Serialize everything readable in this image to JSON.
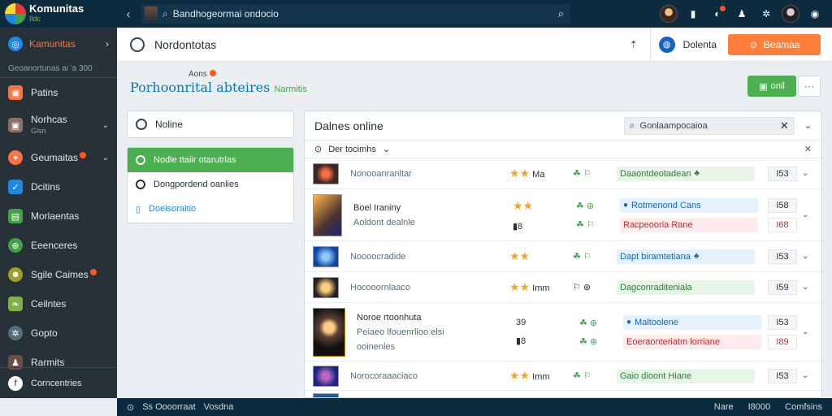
{
  "app": {
    "name": "Komunitas",
    "sub": "Ildc"
  },
  "topbar": {
    "back_icon": "chevron-left-icon",
    "search_value": "Bandhogeormai ondocio",
    "icons": [
      "avatar",
      "bookmark-icon",
      "notification-icon",
      "user-icon",
      "settings-icon",
      "avatar",
      "user-circle-icon"
    ]
  },
  "sidebar": {
    "head": "Kamunitas",
    "sub": "Geoanortunas ai 'a 300",
    "items": [
      {
        "label": "Patins",
        "sub": "",
        "color": "#ff7043"
      },
      {
        "label": "Norhcas",
        "sub": "Glsn",
        "color": "#8d6e63"
      },
      {
        "label": "Geumaitas",
        "sub": "",
        "color": "#ff7043"
      },
      {
        "label": "Dcitins",
        "sub": "",
        "color": "#1e88e5"
      },
      {
        "label": "Morlaentas",
        "sub": "",
        "color": "#43a047"
      },
      {
        "label": "Eeenceres",
        "sub": "",
        "color": "#43a047"
      },
      {
        "label": "Sgile Caimes",
        "sub": "",
        "color": "#9e9d24"
      },
      {
        "label": "Ceilntes",
        "sub": "",
        "color": "#7cb342"
      },
      {
        "label": "Gopto",
        "sub": "",
        "color": "#546e7a"
      },
      {
        "label": "Rarmits",
        "sub": "",
        "color": "#6d4c41"
      }
    ],
    "bottom": "Corncentries"
  },
  "header": {
    "title": "Nordontotas",
    "link": "Dolenta",
    "button": "Beamaa"
  },
  "page": {
    "small": "Aons",
    "heading": "Porhoonrital abteires",
    "heading_green": "Narmitis",
    "add_button": "onil",
    "more": "···"
  },
  "left": {
    "box": "Noline",
    "items": [
      {
        "label": "Nodle ttaiir otarutrlas",
        "state": "active"
      },
      {
        "label": "Dongpordend oanlies",
        "state": "normal"
      },
      {
        "label": "Doeisoraitio",
        "state": "link"
      }
    ]
  },
  "panel": {
    "title": "Dalnes online",
    "search": "Gonlaampocaioa",
    "filter": "Der tocimhs",
    "rows": [
      {
        "title": "Nonooanranltar",
        "lines": [],
        "ratings": [
          "★★",
          "Ma"
        ],
        "mid": [
          "☘ ⚐"
        ],
        "tags": [
          {
            "t": "Daaontdeotadean",
            "c": "green",
            "i": "♣"
          }
        ],
        "nums": [
          {
            "v": "I53",
            "c": ""
          }
        ]
      },
      {
        "title": "Boel Iraniny",
        "lines": [
          "Aoldont dealnle"
        ],
        "ratings": [
          "★★",
          "▮8"
        ],
        "mid": [
          "☘ ⊛",
          "☘ ⚐"
        ],
        "tags": [
          {
            "t": "Rotmenond Cans",
            "c": "blue",
            "i": "●"
          },
          {
            "t": "Racpeooria Rane",
            "c": "red",
            "i": ""
          }
        ],
        "nums": [
          {
            "v": "I58",
            "c": ""
          },
          {
            "v": "I68",
            "c": "red"
          }
        ]
      },
      {
        "title": "Noooocradide",
        "lines": [],
        "ratings": [
          "★★",
          ""
        ],
        "mid": [
          "☘ ⚐"
        ],
        "tags": [
          {
            "t": "Dapt biramtetiana",
            "c": "blue",
            "i": "♣"
          }
        ],
        "nums": [
          {
            "v": "I53",
            "c": ""
          }
        ]
      },
      {
        "title": "Hocooornlaaco",
        "lines": [],
        "ratings": [
          "★★",
          "Imm"
        ],
        "mid": [
          "⚐ ⊛"
        ],
        "tags": [
          {
            "t": "Dagconraditeniala",
            "c": "green",
            "i": ""
          }
        ],
        "nums": [
          {
            "v": "I59",
            "c": ""
          }
        ]
      },
      {
        "title": "Noroe rtoonhuta",
        "lines": [
          "Peiaeo lfouenrlioo elsi",
          "ooinenles"
        ],
        "ratings": [
          "39",
          "▮8"
        ],
        "mid": [
          "☘ ⊛",
          "☘ ⊛"
        ],
        "tags": [
          {
            "t": "Maltoolene",
            "c": "blue",
            "i": "●"
          },
          {
            "t": "Eoeraonteriatm lorriane",
            "c": "red",
            "i": ""
          }
        ],
        "nums": [
          {
            "v": "I53",
            "c": ""
          },
          {
            "v": "I89",
            "c": "red"
          }
        ]
      },
      {
        "title": "Norocoraaaciaco",
        "lines": [],
        "ratings": [
          "★★",
          "Imm"
        ],
        "mid": [
          "☘ ⚐"
        ],
        "tags": [
          {
            "t": "Gaio dioont Hiane",
            "c": "green",
            "i": ""
          }
        ],
        "nums": [
          {
            "v": "I53",
            "c": ""
          }
        ]
      }
    ]
  },
  "status": {
    "left_a": "Ss Oooorraat",
    "left_b": "Vosdna",
    "right": [
      "Nare",
      "I8000",
      "Comfsins"
    ]
  },
  "colors": {
    "topbar": "#0d2b3e",
    "sidebar": "#263238",
    "accent_orange": "#ff7f3a",
    "accent_green": "#4caf50"
  }
}
